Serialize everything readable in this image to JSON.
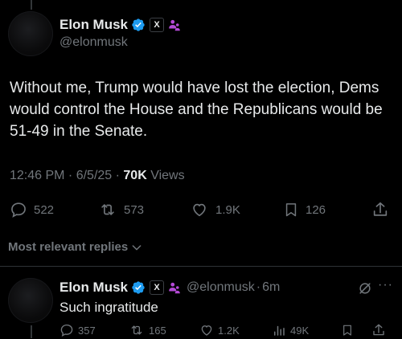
{
  "tweet": {
    "display_name": "Elon Musk",
    "handle": "@elonmusk",
    "x_badge": "X",
    "text": "Without me, Trump would have lost the election, Dems would control the House and the Republicans would be 51-49 in the Senate.",
    "time": "12:46 PM · 6/5/25 · ",
    "views_count": "70K",
    "views_label": " Views",
    "actions": {
      "replies": "522",
      "reposts": "573",
      "likes": "1.9K",
      "bookmarks": "126"
    }
  },
  "replies_sort": {
    "label": "Most relevant replies"
  },
  "reply": {
    "display_name": "Elon Musk",
    "x_badge": "X",
    "handle": "@elonmusk",
    "separator": "·",
    "time": "6m",
    "more": "···",
    "text": "Such ingratitude",
    "actions": {
      "replies": "357",
      "reposts": "165",
      "likes": "1.2K",
      "views": "49K"
    }
  },
  "colors": {
    "background": "#000000",
    "text_primary": "#e7e9ea",
    "text_secondary": "#71767b",
    "verified_blue": "#1d9bf0",
    "gov_purple": "#b44ad6",
    "divider": "#2f3336"
  },
  "icons": [
    "verified-icon",
    "x-affiliate-badge",
    "affiliate-people-icon",
    "reply-icon",
    "repost-icon",
    "like-icon",
    "bookmark-icon",
    "share-icon",
    "views-icon",
    "grok-icon",
    "more-icon",
    "chevron-down-icon"
  ]
}
